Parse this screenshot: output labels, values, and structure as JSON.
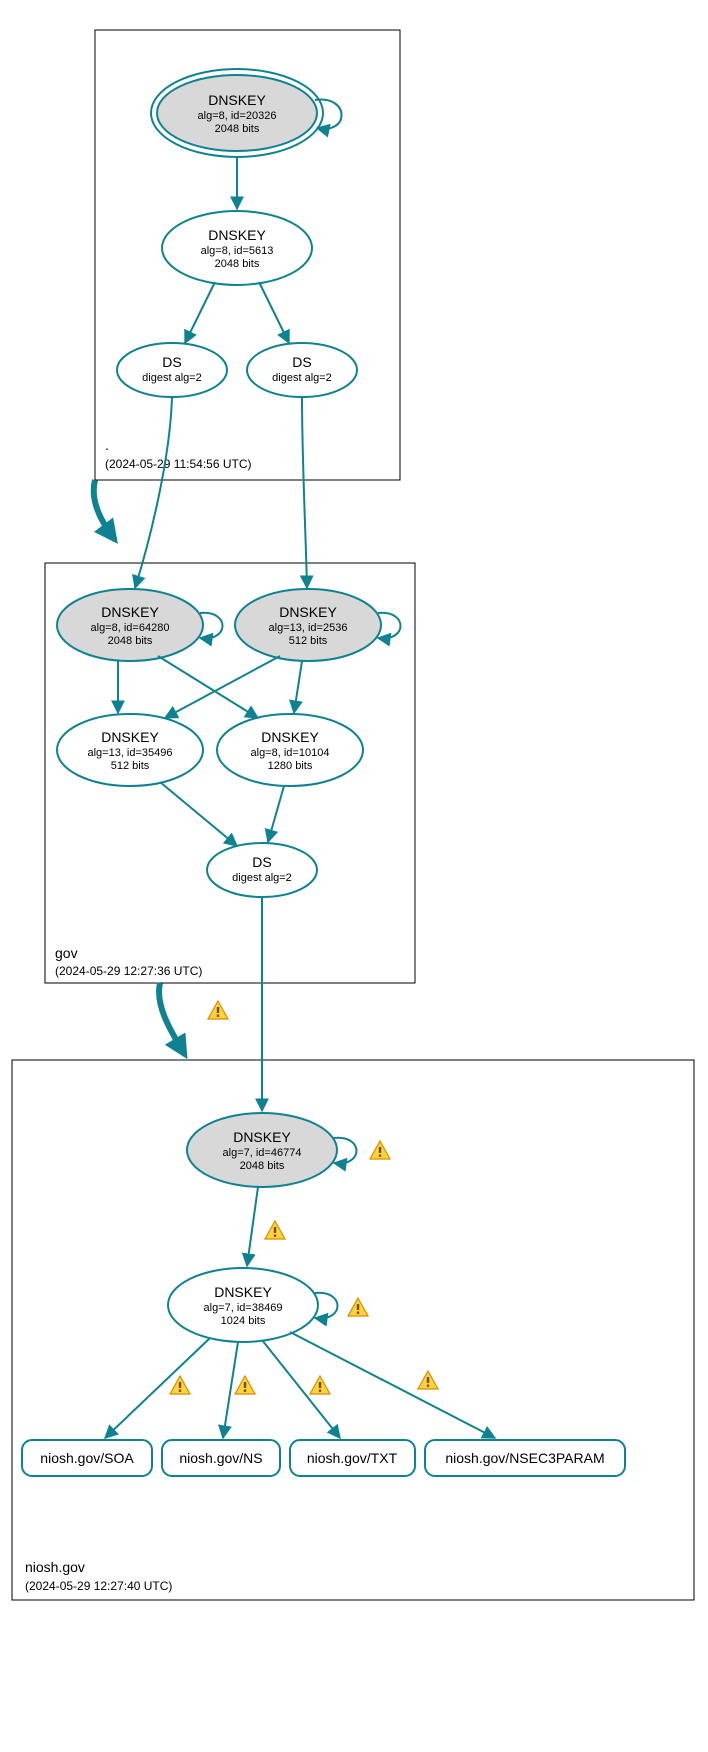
{
  "zones": {
    "root": {
      "name": ".",
      "timestamp": "(2024-05-29 11:54:56 UTC)"
    },
    "gov": {
      "name": "gov",
      "timestamp": "(2024-05-29 12:27:36 UTC)"
    },
    "niosh": {
      "name": "niosh.gov",
      "timestamp": "(2024-05-29 12:27:40 UTC)"
    }
  },
  "nodes": {
    "root_ksk": {
      "title": "DNSKEY",
      "line1": "alg=8, id=20326",
      "line2": "2048 bits"
    },
    "root_zsk": {
      "title": "DNSKEY",
      "line1": "alg=8, id=5613",
      "line2": "2048 bits"
    },
    "root_ds1": {
      "title": "DS",
      "line1": "digest alg=2"
    },
    "root_ds2": {
      "title": "DS",
      "line1": "digest alg=2"
    },
    "gov_key1": {
      "title": "DNSKEY",
      "line1": "alg=8, id=64280",
      "line2": "2048 bits"
    },
    "gov_key2": {
      "title": "DNSKEY",
      "line1": "alg=13, id=2536",
      "line2": "512 bits"
    },
    "gov_key3": {
      "title": "DNSKEY",
      "line1": "alg=13, id=35496",
      "line2": "512 bits"
    },
    "gov_key4": {
      "title": "DNSKEY",
      "line1": "alg=8, id=10104",
      "line2": "1280 bits"
    },
    "gov_ds": {
      "title": "DS",
      "line1": "digest alg=2"
    },
    "niosh_ksk": {
      "title": "DNSKEY",
      "line1": "alg=7, id=46774",
      "line2": "2048 bits"
    },
    "niosh_zsk": {
      "title": "DNSKEY",
      "line1": "alg=7, id=38469",
      "line2": "1024 bits"
    }
  },
  "records": {
    "soa": "niosh.gov/SOA",
    "ns": "niosh.gov/NS",
    "txt": "niosh.gov/TXT",
    "nsec3": "niosh.gov/NSEC3PARAM"
  }
}
